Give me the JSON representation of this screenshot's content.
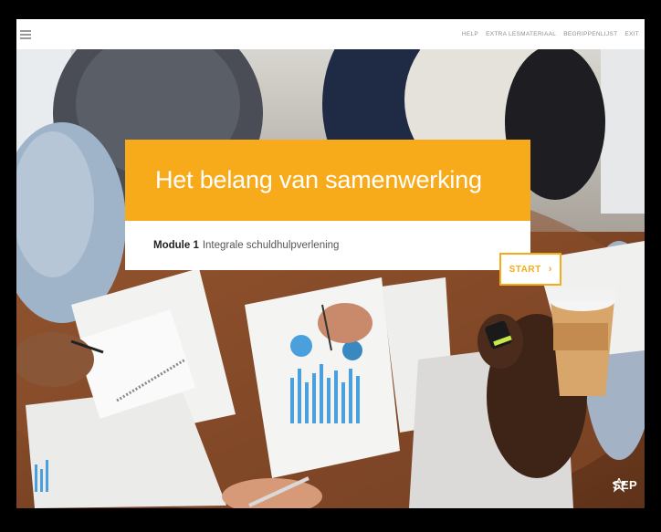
{
  "header": {
    "menu_icon": "hamburger-menu-icon",
    "nav": [
      {
        "label": "HELP"
      },
      {
        "label": "EXTRA LESMATERIAAL"
      },
      {
        "label": "BEGRIPPENLIJST"
      },
      {
        "label": "EXIT"
      }
    ]
  },
  "hero": {
    "title": "Het belang van samenwerking",
    "module_label": "Module 1",
    "module_name": "Integrale schuldhulpverlening",
    "start_label": "START",
    "start_icon": "chevron-right-icon"
  },
  "footer": {
    "logo_text": "SEP",
    "logo_icon": "sep-logo-icon"
  },
  "colors": {
    "accent": "#f7ab1b",
    "title_text": "#ffffff",
    "background_frame": "#000000"
  }
}
